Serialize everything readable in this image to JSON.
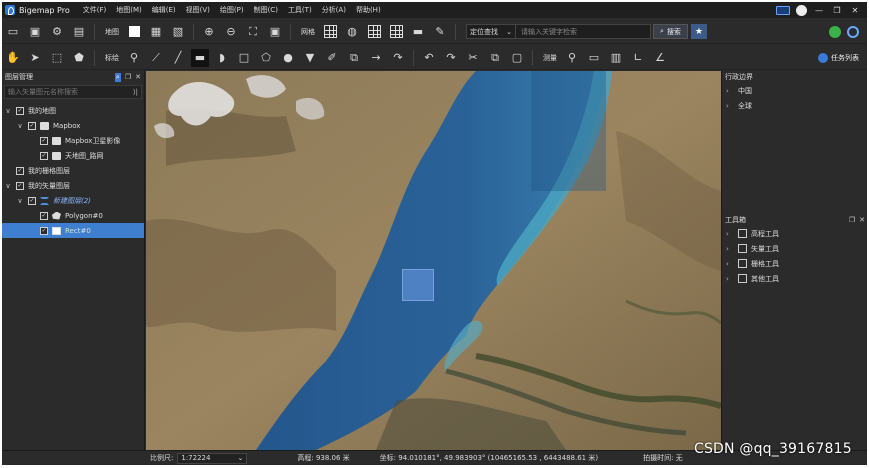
{
  "app": {
    "title": "Bigemap Pro"
  },
  "menu": [
    "文件(F)",
    "地图(M)",
    "编辑(E)",
    "视图(V)",
    "绘图(P)",
    "制图(C)",
    "工具(T)",
    "分析(A)",
    "帮助(H)"
  ],
  "window_controls": {
    "minimize": "—",
    "maximize": "❐",
    "close": "✕"
  },
  "toolbar1": {
    "map_label": "地图",
    "grid_label": "网格",
    "search_mode": "定位查找",
    "search_placeholder": "请输入关键字检索",
    "search_button": "搜索"
  },
  "toolbar2": {
    "mark_label": "标绘",
    "measure_label": "测量",
    "task_list": "任务列表"
  },
  "layer_panel": {
    "title": "图层管理",
    "search_placeholder": "输入矢量图元名称搜索",
    "tree": [
      {
        "label": "我的地图",
        "level": 0,
        "arrow": "∨",
        "icon": "none",
        "checked": true
      },
      {
        "label": "Mapbox",
        "level": 1,
        "arrow": "∨",
        "icon": "folder",
        "checked": true
      },
      {
        "label": "Mapbox卫星影像",
        "level": 2,
        "arrow": "",
        "icon": "folder",
        "checked": true
      },
      {
        "label": "天地图_路网",
        "level": 2,
        "arrow": "",
        "icon": "folder",
        "checked": true
      },
      {
        "label": "我的栅格图层",
        "level": 0,
        "arrow": "",
        "icon": "none",
        "checked": true
      },
      {
        "label": "我的矢量图层",
        "level": 0,
        "arrow": "∨",
        "icon": "none",
        "checked": true
      },
      {
        "label": "新建图层(2)",
        "level": 1,
        "arrow": "∨",
        "icon": "layers",
        "checked": true
      },
      {
        "label": "Polygon#0",
        "level": 2,
        "arrow": "",
        "icon": "poly",
        "checked": true
      },
      {
        "label": "Rect#0",
        "level": 2,
        "arrow": "",
        "icon": "rect",
        "checked": true
      }
    ]
  },
  "admin_panel": {
    "title": "行政边界",
    "items": [
      "中国",
      "全球"
    ]
  },
  "toolbox_panel": {
    "title": "工具箱",
    "items": [
      "高程工具",
      "矢量工具",
      "栅格工具",
      "其他工具"
    ]
  },
  "status": {
    "scale_label": "比例尺:",
    "scale_value": "1:72224",
    "elevation": "高程: 938.06 米",
    "coords": "坐标: 94.010181°, 49.983903°  (10465165.53 , 6443488.61 米)",
    "capture_time": "拍摄时间: 无"
  },
  "watermark": "CSDN @qq_39167815",
  "colors": {
    "accent": "#3f7fd0",
    "panel": "#2b2b2b",
    "lake": "#2a5d92"
  }
}
